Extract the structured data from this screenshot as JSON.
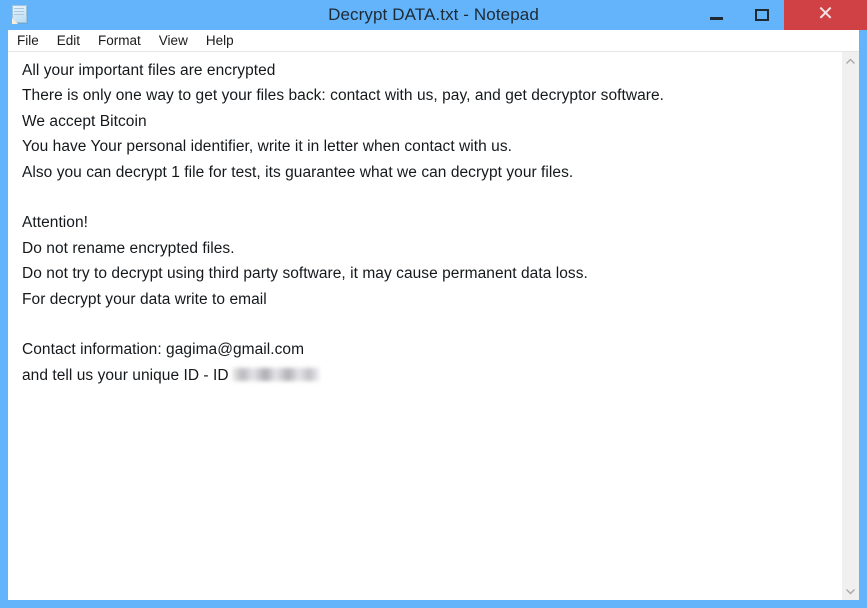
{
  "window": {
    "title": "Decrypt DATA.txt - Notepad",
    "app_icon": "notepad-document-icon",
    "titlebar_color": "#63b4fb",
    "close_button_color": "#cf4145",
    "controls": {
      "minimize_label": "—",
      "maximize_label": "□",
      "close_label": "✕"
    }
  },
  "menubar": {
    "items": [
      {
        "label": "File"
      },
      {
        "label": "Edit"
      },
      {
        "label": "Format"
      },
      {
        "label": "View"
      },
      {
        "label": "Help"
      }
    ]
  },
  "document": {
    "lines": [
      "All your important files are encrypted",
      "There is only one way to get your files back: contact with us, pay, and get decryptor software.",
      "We accept Bitcoin",
      "You have Your personal identifier, write it in letter when contact with us.",
      "Also you can decrypt 1 file for test, its guarantee what we can decrypt your files.",
      "",
      "Attention!",
      "Do not rename encrypted files.",
      "Do not try to decrypt using third party software, it may cause permanent data loss.",
      "For decrypt your data write to email",
      "",
      "Contact information: gagima@gmail.com"
    ],
    "final_line_prefix": "and tell us your unique ID - ID",
    "final_line_redacted": true,
    "email": "gagima@gmail.com"
  },
  "scrollbar": {
    "up_arrow": "chevron-up-icon",
    "down_arrow": "chevron-down-icon"
  }
}
